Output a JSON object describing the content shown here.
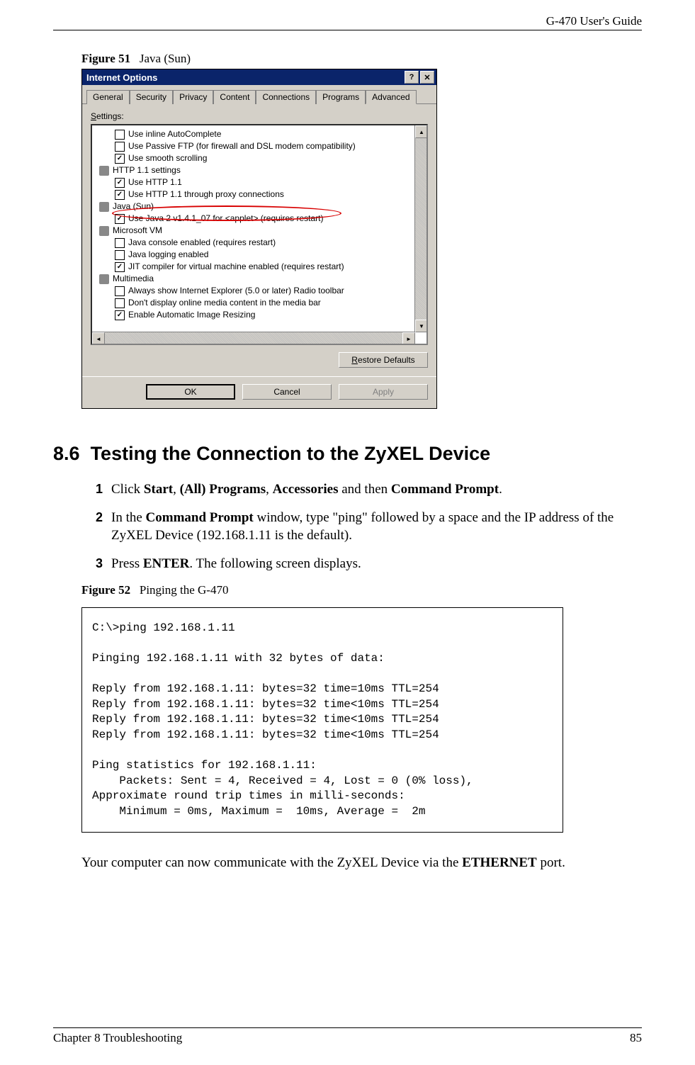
{
  "header": {
    "title": "G-470 User's Guide"
  },
  "figure51": {
    "label": "Figure 51",
    "caption": "Java (Sun)"
  },
  "dialog": {
    "title": "Internet Options",
    "tabs": [
      "General",
      "Security",
      "Privacy",
      "Content",
      "Connections",
      "Programs",
      "Advanced"
    ],
    "selected_tab": "Advanced",
    "settings_label": "Settings:",
    "tree": [
      {
        "type": "item",
        "level": 1,
        "checked": false,
        "label": "Use inline AutoComplete"
      },
      {
        "type": "item",
        "level": 1,
        "checked": false,
        "label": "Use Passive FTP (for firewall and DSL modem compatibility)"
      },
      {
        "type": "item",
        "level": 1,
        "checked": true,
        "label": "Use smooth scrolling"
      },
      {
        "type": "group",
        "label": "HTTP 1.1 settings"
      },
      {
        "type": "item",
        "level": 1,
        "checked": true,
        "label": "Use HTTP 1.1"
      },
      {
        "type": "item",
        "level": 1,
        "checked": true,
        "label": "Use HTTP 1.1 through proxy connections"
      },
      {
        "type": "group",
        "label": "Java (Sun)"
      },
      {
        "type": "item",
        "level": 1,
        "checked": true,
        "label": "Use Java 2 v1.4.1_07 for <applet> (requires restart)",
        "highlight": true
      },
      {
        "type": "group",
        "label": "Microsoft VM"
      },
      {
        "type": "item",
        "level": 1,
        "checked": false,
        "label": "Java console enabled (requires restart)"
      },
      {
        "type": "item",
        "level": 1,
        "checked": false,
        "label": "Java logging enabled"
      },
      {
        "type": "item",
        "level": 1,
        "checked": true,
        "label": "JIT compiler for virtual machine enabled (requires restart)"
      },
      {
        "type": "group",
        "label": "Multimedia"
      },
      {
        "type": "item",
        "level": 1,
        "checked": false,
        "label": "Always show Internet Explorer (5.0 or later) Radio toolbar"
      },
      {
        "type": "item",
        "level": 1,
        "checked": false,
        "label": "Don't display online media content in the media bar"
      },
      {
        "type": "item",
        "level": 1,
        "checked": true,
        "label": "Enable Automatic Image Resizing"
      }
    ],
    "restore_label": "Restore Defaults",
    "ok_label": "OK",
    "cancel_label": "Cancel",
    "apply_label": "Apply"
  },
  "section": {
    "number": "8.6",
    "title": "Testing the Connection to the ZyXEL Device"
  },
  "steps": [
    {
      "n": "1",
      "html": "Click <b>Start</b>, <b>(All) Programs</b>, <b>Accessories</b> and then <b>Command Prompt</b>."
    },
    {
      "n": "2",
      "html": "In the <b>Command Prompt</b> window, type \"ping\" followed by a space and the IP address of the ZyXEL Device (192.168.1.11 is the default)."
    },
    {
      "n": "3",
      "html": "Press <b>ENTER</b>. The following screen displays."
    }
  ],
  "figure52": {
    "label": "Figure 52",
    "caption": "Pinging the G-470"
  },
  "console": "C:\\>ping 192.168.1.11\n\nPinging 192.168.1.11 with 32 bytes of data:\n\nReply from 192.168.1.11: bytes=32 time=10ms TTL=254\nReply from 192.168.1.11: bytes=32 time<10ms TTL=254\nReply from 192.168.1.11: bytes=32 time<10ms TTL=254\nReply from 192.168.1.11: bytes=32 time<10ms TTL=254\n\nPing statistics for 192.168.1.11:\n    Packets: Sent = 4, Received = 4, Lost = 0 (0% loss),\nApproximate round trip times in milli-seconds:\n    Minimum = 0ms, Maximum =  10ms, Average =  2m",
  "conclusion": "Your computer can now communicate with the ZyXEL Device via the <b>ETHERNET</b> port.",
  "footer": {
    "left": "Chapter 8 Troubleshooting",
    "right": "85"
  }
}
